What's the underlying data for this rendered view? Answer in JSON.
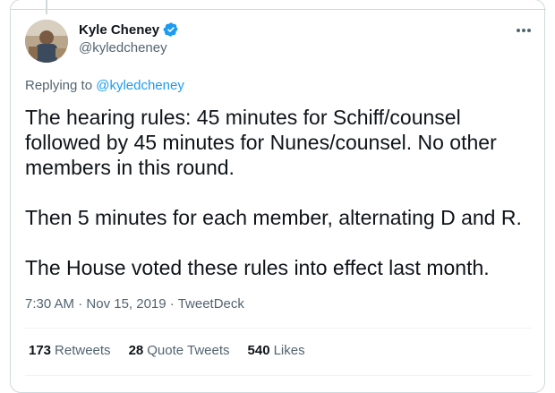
{
  "tweet": {
    "author_name": "Kyle Cheney",
    "author_handle": "@kyledcheney",
    "replying_prefix": "Replying to",
    "replying_to": "@kyledcheney",
    "paragraphs": [
      "The hearing rules: 45 minutes for Schiff/counsel followed by 45 minutes for Nunes/counsel. No other members in this round.",
      "Then 5 minutes for each member, alternating D and R.",
      "The House voted these rules into effect last month."
    ],
    "time": "7:30 AM",
    "separator": "·",
    "date": "Nov 15, 2019",
    "source": "TweetDeck"
  },
  "stats": {
    "retweets_count": "173",
    "retweets_label": "Retweets",
    "quotes_count": "28",
    "quotes_label": "Quote Tweets",
    "likes_count": "540",
    "likes_label": "Likes"
  },
  "icons": {
    "verified": "verified-badge-icon",
    "more": "more-dots-icon"
  },
  "colors": {
    "accent": "#1d9bf0",
    "text": "#0f1419",
    "muted": "#536471",
    "border": "#cfd9de"
  }
}
